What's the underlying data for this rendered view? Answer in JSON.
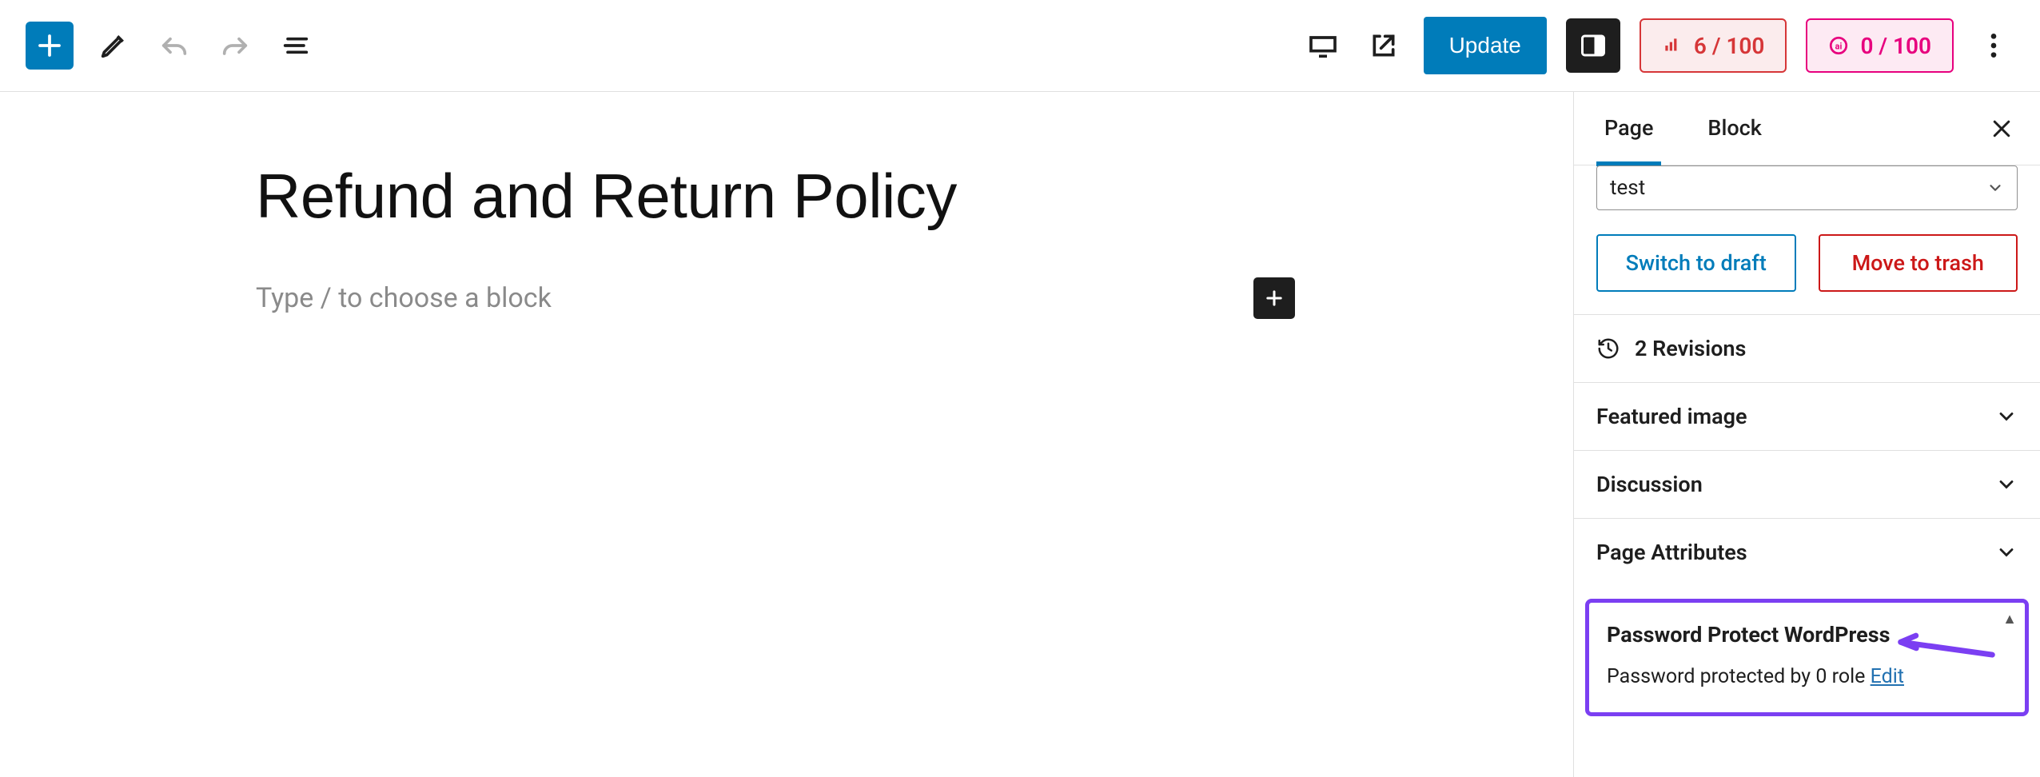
{
  "toolbar": {
    "update_label": "Update",
    "score_seo": "6 / 100",
    "score_ai": "0 / 100"
  },
  "editor": {
    "title": "Refund and Return Policy",
    "block_placeholder": "Type / to choose a block"
  },
  "sidebar": {
    "tabs": {
      "page": "Page",
      "block": "Block"
    },
    "template_value": "test",
    "buttons": {
      "draft": "Switch to draft",
      "trash": "Move to trash"
    },
    "revisions": "2 Revisions",
    "panels": {
      "featured": "Featured image",
      "discussion": "Discussion",
      "attributes": "Page Attributes"
    },
    "password_protect": {
      "title": "Password Protect WordPress",
      "prefix": "Password protected by 0 role ",
      "edit": "Edit"
    }
  }
}
